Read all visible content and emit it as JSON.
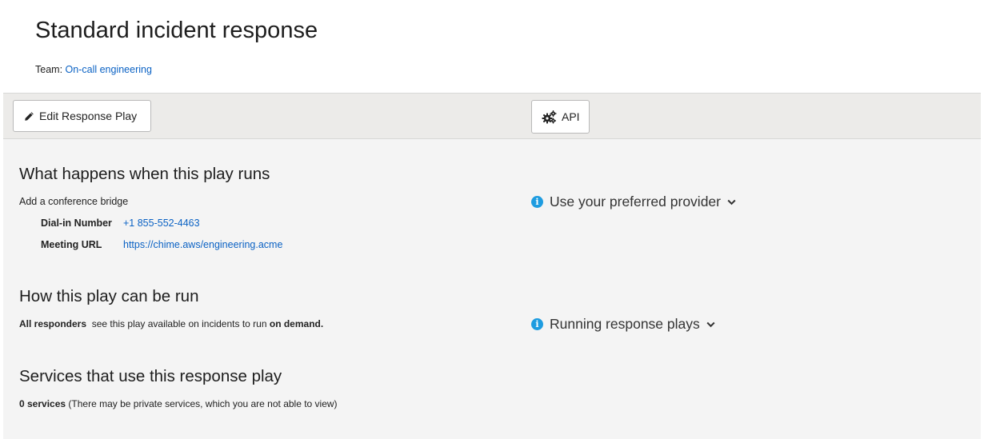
{
  "header": {
    "title": "Standard incident response",
    "team_label": "Team:",
    "team_name": "On-call engineering"
  },
  "toolbar": {
    "edit_label": "Edit Response Play",
    "api_label": "API"
  },
  "what_happens": {
    "title": "What happens when this play runs",
    "action": "Add a conference bridge",
    "dial_in_label": "Dial-in Number",
    "dial_in_value": "+1 855-552-4463",
    "meeting_url_label": "Meeting URL",
    "meeting_url_value": "https://chime.aws/engineering.acme",
    "info_link": "Use your preferred provider"
  },
  "how_run": {
    "title": "How this play can be run",
    "responders": "All responders",
    "description": "see this play available on incidents to run",
    "mode": "on demand.",
    "info_link": "Running response plays"
  },
  "services": {
    "title": "Services that use this response play",
    "count": "0 services",
    "note": "(There may be private services, which you are not able to view)"
  },
  "colors": {
    "link": "#0b62c4",
    "info": "#1e9ce0",
    "background": "#f4f4f4",
    "toolbar": "#ecebe9"
  },
  "icons": [
    "pencil-icon",
    "gears-icon",
    "info-icon",
    "chevron-down-icon"
  ]
}
